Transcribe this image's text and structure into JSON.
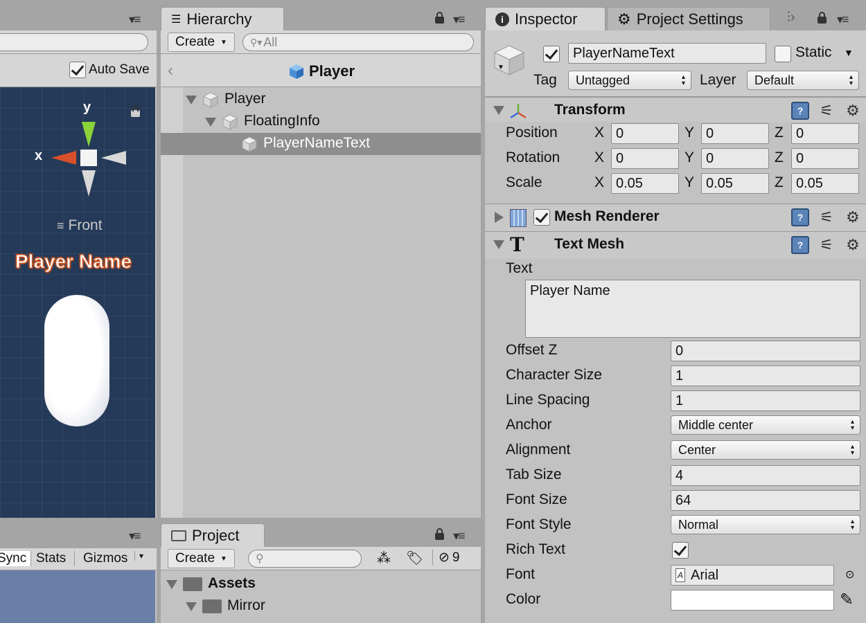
{
  "scene": {
    "auto_save_label": "Auto Save",
    "auto_save_checked": true,
    "gizmo_y": "y",
    "gizmo_x": "x",
    "view_label": "Front",
    "preview_text": "Player Name"
  },
  "game": {
    "tabs": [
      "Sync",
      "Stats",
      "Gizmos"
    ]
  },
  "hierarchy": {
    "tab_title": "Hierarchy",
    "create_label": "Create",
    "search_placeholder": "All",
    "breadcrumb_title": "Player",
    "items": [
      {
        "label": "Player",
        "depth": 0,
        "expanded": true,
        "selected": false
      },
      {
        "label": "FloatingInfo",
        "depth": 1,
        "expanded": true,
        "selected": false
      },
      {
        "label": "PlayerNameText",
        "depth": 2,
        "expanded": false,
        "selected": true
      }
    ]
  },
  "project": {
    "tab_title": "Project",
    "create_label": "Create",
    "hidden_count": "9",
    "items": [
      {
        "label": "Assets",
        "bold": true
      },
      {
        "label": "Mirror",
        "bold": false
      }
    ]
  },
  "inspector": {
    "tab_title": "Inspector",
    "settings_tab_title": "Project Settings",
    "object_name": "PlayerNameText",
    "active_checked": true,
    "static_label": "Static",
    "static_checked": false,
    "tag_label": "Tag",
    "tag_value": "Untagged",
    "layer_label": "Layer",
    "layer_value": "Default",
    "transform": {
      "title": "Transform",
      "rows": [
        {
          "label": "Position",
          "x": "0",
          "y": "0",
          "z": "0"
        },
        {
          "label": "Rotation",
          "x": "0",
          "y": "0",
          "z": "0"
        },
        {
          "label": "Scale",
          "x": "0.05",
          "y": "0.05",
          "z": "0.05"
        }
      ],
      "axis_x": "X",
      "axis_y": "Y",
      "axis_z": "Z"
    },
    "mesh_renderer": {
      "title": "Mesh Renderer",
      "enabled": true
    },
    "text_mesh": {
      "title": "Text Mesh",
      "text_label": "Text",
      "text_value": "Player Name",
      "offset_z_label": "Offset Z",
      "offset_z": "0",
      "char_size_label": "Character Size",
      "char_size": "1",
      "line_spacing_label": "Line Spacing",
      "line_spacing": "1",
      "anchor_label": "Anchor",
      "anchor": "Middle center",
      "alignment_label": "Alignment",
      "alignment": "Center",
      "tab_size_label": "Tab Size",
      "tab_size": "4",
      "font_size_label": "Font Size",
      "font_size": "64",
      "font_style_label": "Font Style",
      "font_style": "Normal",
      "rich_text_label": "Rich Text",
      "rich_text": true,
      "font_label": "Font",
      "font": "Arial",
      "color_label": "Color",
      "color": "#ffffff"
    }
  }
}
